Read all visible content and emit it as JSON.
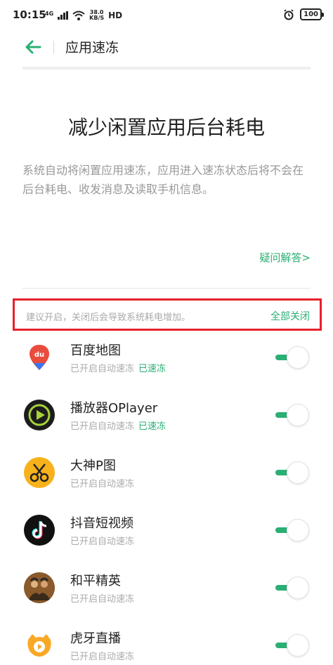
{
  "status_bar": {
    "time": "10:15",
    "net_type": "4G",
    "net_speed": "38.0",
    "net_unit": "KB/S",
    "hd": "HD",
    "battery": "100"
  },
  "toolbar": {
    "title": "应用速冻"
  },
  "intro": {
    "headline": "减少闲置应用后台耗电",
    "description": "系统自动将闲置应用速冻，应用进入速冻状态后将不会在后台耗电、收发消息及读取手机信息。",
    "faq_link": "疑问解答>"
  },
  "notice": {
    "text": "建议开启，关闭后会导致系统耗电增加。",
    "close_all": "全部关闭"
  },
  "colors": {
    "accent": "#2aaf74",
    "highlight_border": "#e8202c"
  },
  "apps": [
    {
      "name": "百度地图",
      "status": "已开启自动速冻",
      "frozen_label": "已速冻",
      "icon": "baidu-map-icon",
      "enabled": true
    },
    {
      "name": "播放器OPlayer",
      "status": "已开启自动速冻",
      "frozen_label": "已速冻",
      "icon": "oplayer-icon",
      "enabled": true
    },
    {
      "name": "大神P图",
      "status": "已开启自动速冻",
      "frozen_label": "",
      "icon": "dashen-ptu-icon",
      "enabled": true
    },
    {
      "name": "抖音短视频",
      "status": "已开启自动速冻",
      "frozen_label": "",
      "icon": "douyin-icon",
      "enabled": true
    },
    {
      "name": "和平精英",
      "status": "已开启自动速冻",
      "frozen_label": "",
      "icon": "peace-elite-icon",
      "enabled": true
    },
    {
      "name": "虎牙直播",
      "status": "已开启自动速冻",
      "frozen_label": "",
      "icon": "huya-icon",
      "enabled": true
    }
  ]
}
